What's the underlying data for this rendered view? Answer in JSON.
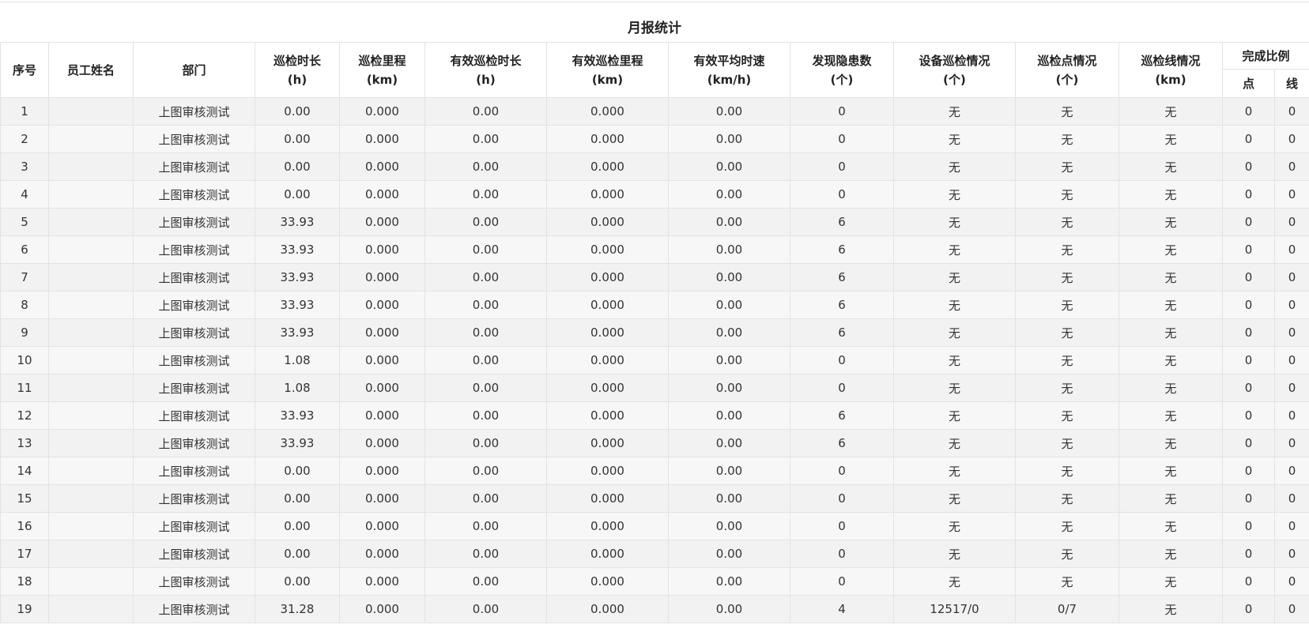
{
  "title": "月报统计",
  "columns": {
    "index": "序号",
    "name": "员工姓名",
    "dept": "部门",
    "duration": [
      "巡检时长",
      "(h)"
    ],
    "mileage": [
      "巡检里程",
      "(km)"
    ],
    "eff_duration": [
      "有效巡检时长",
      "(h)"
    ],
    "eff_mileage": [
      "有效巡检里程",
      "(km)"
    ],
    "avg_speed": [
      "有效平均时速",
      "(km/h)"
    ],
    "hazards": [
      "发现隐患数",
      "(个)"
    ],
    "device": [
      "设备巡检情况",
      "(个)"
    ],
    "points": [
      "巡检点情况",
      "(个)"
    ],
    "lines": [
      "巡检线情况",
      "(km)"
    ],
    "ratio": "完成比例",
    "ratio_point": "点",
    "ratio_line": "线"
  },
  "rows": [
    [
      "1",
      "",
      "上图审核测试",
      "0.00",
      "0.000",
      "0.00",
      "0.000",
      "0.00",
      "0",
      "无",
      "无",
      "无",
      "0",
      "0"
    ],
    [
      "2",
      "",
      "上图审核测试",
      "0.00",
      "0.000",
      "0.00",
      "0.000",
      "0.00",
      "0",
      "无",
      "无",
      "无",
      "0",
      "0"
    ],
    [
      "3",
      "",
      "上图审核测试",
      "0.00",
      "0.000",
      "0.00",
      "0.000",
      "0.00",
      "0",
      "无",
      "无",
      "无",
      "0",
      "0"
    ],
    [
      "4",
      "",
      "上图审核测试",
      "0.00",
      "0.000",
      "0.00",
      "0.000",
      "0.00",
      "0",
      "无",
      "无",
      "无",
      "0",
      "0"
    ],
    [
      "5",
      "",
      "上图审核测试",
      "33.93",
      "0.000",
      "0.00",
      "0.000",
      "0.00",
      "6",
      "无",
      "无",
      "无",
      "0",
      "0"
    ],
    [
      "6",
      "",
      "上图审核测试",
      "33.93",
      "0.000",
      "0.00",
      "0.000",
      "0.00",
      "6",
      "无",
      "无",
      "无",
      "0",
      "0"
    ],
    [
      "7",
      "",
      "上图审核测试",
      "33.93",
      "0.000",
      "0.00",
      "0.000",
      "0.00",
      "6",
      "无",
      "无",
      "无",
      "0",
      "0"
    ],
    [
      "8",
      "",
      "上图审核测试",
      "33.93",
      "0.000",
      "0.00",
      "0.000",
      "0.00",
      "6",
      "无",
      "无",
      "无",
      "0",
      "0"
    ],
    [
      "9",
      "",
      "上图审核测试",
      "33.93",
      "0.000",
      "0.00",
      "0.000",
      "0.00",
      "6",
      "无",
      "无",
      "无",
      "0",
      "0"
    ],
    [
      "10",
      "",
      "上图审核测试",
      "1.08",
      "0.000",
      "0.00",
      "0.000",
      "0.00",
      "0",
      "无",
      "无",
      "无",
      "0",
      "0"
    ],
    [
      "11",
      "",
      "上图审核测试",
      "1.08",
      "0.000",
      "0.00",
      "0.000",
      "0.00",
      "0",
      "无",
      "无",
      "无",
      "0",
      "0"
    ],
    [
      "12",
      "",
      "上图审核测试",
      "33.93",
      "0.000",
      "0.00",
      "0.000",
      "0.00",
      "6",
      "无",
      "无",
      "无",
      "0",
      "0"
    ],
    [
      "13",
      "",
      "上图审核测试",
      "33.93",
      "0.000",
      "0.00",
      "0.000",
      "0.00",
      "6",
      "无",
      "无",
      "无",
      "0",
      "0"
    ],
    [
      "14",
      "",
      "上图审核测试",
      "0.00",
      "0.000",
      "0.00",
      "0.000",
      "0.00",
      "0",
      "无",
      "无",
      "无",
      "0",
      "0"
    ],
    [
      "15",
      "",
      "上图审核测试",
      "0.00",
      "0.000",
      "0.00",
      "0.000",
      "0.00",
      "0",
      "无",
      "无",
      "无",
      "0",
      "0"
    ],
    [
      "16",
      "",
      "上图审核测试",
      "0.00",
      "0.000",
      "0.00",
      "0.000",
      "0.00",
      "0",
      "无",
      "无",
      "无",
      "0",
      "0"
    ],
    [
      "17",
      "",
      "上图审核测试",
      "0.00",
      "0.000",
      "0.00",
      "0.000",
      "0.00",
      "0",
      "无",
      "无",
      "无",
      "0",
      "0"
    ],
    [
      "18",
      "",
      "上图审核测试",
      "0.00",
      "0.000",
      "0.00",
      "0.000",
      "0.00",
      "0",
      "无",
      "无",
      "无",
      "0",
      "0"
    ],
    [
      "19",
      "",
      "上图审核测试",
      "31.28",
      "0.000",
      "0.00",
      "0.000",
      "0.00",
      "4",
      "12517/0",
      "0/7",
      "无",
      "0",
      "0"
    ]
  ]
}
